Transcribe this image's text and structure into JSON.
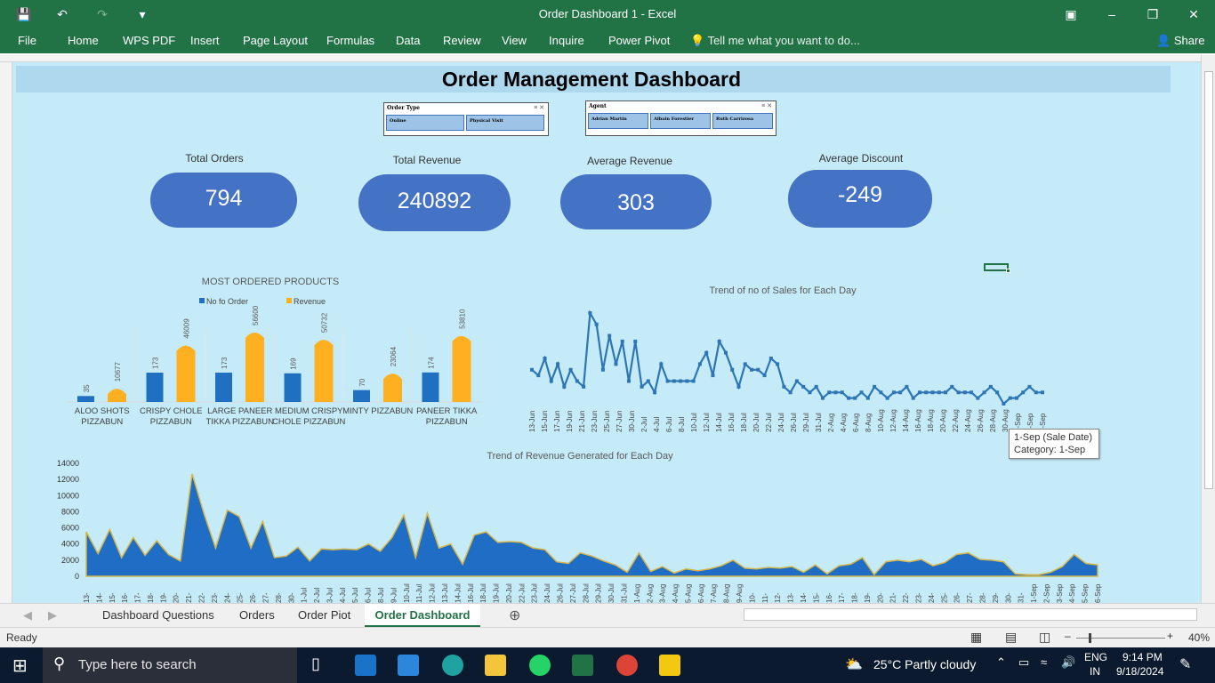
{
  "window": {
    "title": "Order Dashboard 1 - Excel"
  },
  "ribbon": {
    "tabs": [
      "File",
      "Home",
      "WPS PDF",
      "Insert",
      "Page Layout",
      "Formulas",
      "Data",
      "Review",
      "View",
      "Inquire",
      "Power Pivot"
    ],
    "tell_me": "Tell me what you want to do...",
    "share": "Share"
  },
  "dashboard": {
    "title": "Order Management Dashboard",
    "slicers": [
      {
        "header": "Order Type",
        "items": [
          "Online",
          "Physical Visit"
        ]
      },
      {
        "header": "Agent",
        "items": [
          "Adrian Martin",
          "Albain Forestier",
          "Ruth Carrizosa"
        ]
      }
    ],
    "kpis": [
      {
        "label": "Total Orders",
        "value": "794"
      },
      {
        "label": "Total Revenue",
        "value": "240892"
      },
      {
        "label": "Average Revenue",
        "value": "303"
      },
      {
        "label": "Average Discount",
        "value": "-249"
      }
    ]
  },
  "tooltip": {
    "line1": "1-Sep (Sale Date)",
    "line2": "Category: 1-Sep"
  },
  "sheet_tabs": [
    "Dashboard Questions",
    "Orders",
    "Order Piot",
    "Order Dashboard"
  ],
  "status": {
    "ready": "Ready",
    "zoom": "40%"
  },
  "taskbar": {
    "search_placeholder": "Type here to search",
    "weather": "25°C  Partly cloudy",
    "lang1": "ENG",
    "lang2": "IN",
    "time": "9:14 PM",
    "date": "9/18/2024",
    "notif_count": "1"
  },
  "colors": {
    "excel_green": "#217346",
    "kpi_blue": "#4472c4",
    "bar_blue": "#1f70c1",
    "bar_orange": "#ffb020",
    "sheet_bg": "#c5ebf8"
  },
  "chart_data": [
    {
      "type": "bar",
      "title": "MOST ORDERED PRODUCTS",
      "categories": [
        "ALOO SHOTS PIZZABUN",
        "CRISPY CHOLE PIZZABUN",
        "LARGE PANEER TIKKA PIZZABUN",
        "MEDIUM CRISPY CHOLE PIZZABUN",
        "MINTY PIZZABUN",
        "PANEER TIKKA PIZZABUN"
      ],
      "series": [
        {
          "name": "No fo Order",
          "values": [
            35,
            173,
            173,
            169,
            70,
            174
          ]
        },
        {
          "name": "Revenue",
          "values": [
            10677,
            46009,
            56600,
            50732,
            23064,
            53810
          ]
        }
      ],
      "legend": "top"
    },
    {
      "type": "line",
      "title": "Trend of no of Sales for Each Day",
      "x_labels": [
        "13-Jun",
        "15-Jun",
        "17-Jun",
        "19-Jun",
        "21-Jun",
        "23-Jun",
        "25-Jun",
        "27-Jun",
        "30-Jun",
        "2-Jul",
        "4-Jul",
        "6-Jul",
        "8-Jul",
        "10-Jul",
        "12-Jul",
        "14-Jul",
        "16-Jul",
        "18-Jul",
        "20-Jul",
        "22-Jul",
        "24-Jul",
        "26-Jul",
        "29-Jul",
        "31-Jul",
        "2-Aug",
        "4-Aug",
        "6-Aug",
        "8-Aug",
        "10-Aug",
        "12-Aug",
        "14-Aug",
        "16-Aug",
        "18-Aug",
        "20-Aug",
        "22-Aug",
        "24-Aug",
        "26-Aug",
        "28-Aug",
        "30-Aug",
        "1-Sep",
        "3-Sep",
        "5-Sep"
      ],
      "values": [
        6,
        5,
        8,
        4,
        7,
        3,
        6,
        4,
        3,
        16,
        14,
        6,
        12,
        7,
        11,
        4,
        11,
        3,
        4,
        2,
        7,
        4,
        4,
        4,
        4,
        4,
        7,
        9,
        5,
        11,
        9,
        6,
        3,
        7,
        6,
        6,
        5,
        8,
        7,
        3,
        2,
        4,
        3,
        2,
        3,
        1,
        2,
        2,
        2,
        1,
        1,
        2,
        1,
        3,
        2,
        1,
        2,
        2,
        3,
        1,
        2,
        2,
        2,
        2,
        2,
        3,
        2,
        2,
        2,
        1,
        2,
        3,
        2,
        0,
        1,
        1,
        2,
        3,
        2,
        2
      ],
      "grid": false
    },
    {
      "type": "area",
      "title": "Trend of Revenue Generated for Each Day",
      "y_ticks": [
        0,
        2000,
        4000,
        6000,
        8000,
        10000,
        12000,
        14000
      ],
      "ylim": [
        0,
        14000
      ],
      "x_labels": [
        "13-",
        "14-",
        "15-",
        "16-",
        "17-",
        "18-",
        "19-",
        "20-",
        "21-",
        "22-",
        "23-",
        "24-",
        "25-",
        "26-",
        "27-",
        "28-",
        "30-",
        "1-Jul",
        "2-Jul",
        "3-Jul",
        "4-Jul",
        "5-Jul",
        "6-Jul",
        "8-Jul",
        "9-Jul",
        "10-Jul",
        "11-Jul",
        "12-Jul",
        "13-Jul",
        "14-Jul",
        "16-Jul",
        "18-Jul",
        "19-Jul",
        "20-Jul",
        "22-Jul",
        "23-Jul",
        "24-Jul",
        "26-Jul",
        "27-Jul",
        "28-Jul",
        "29-Jul",
        "30-Jul",
        "31-Jul",
        "1-Aug",
        "2-Aug",
        "3-Aug",
        "4-Aug",
        "5-Aug",
        "6-Aug",
        "7-Aug",
        "8-Aug",
        "9-Aug",
        "10-",
        "11-",
        "12-",
        "13-",
        "14-",
        "15-",
        "16-",
        "17-",
        "18-",
        "19-",
        "20-",
        "21-",
        "22-",
        "23-",
        "24-",
        "25-",
        "26-",
        "27-",
        "28-",
        "29-",
        "30-",
        "31-",
        "1-Sep",
        "2-Sep",
        "3-Sep",
        "4-Sep",
        "5-Sep",
        "6-Sep"
      ],
      "values": [
        5500,
        2800,
        5800,
        2300,
        4800,
        2600,
        4400,
        2700,
        1900,
        12700,
        7800,
        3500,
        8200,
        7400,
        3500,
        6800,
        2300,
        2500,
        3600,
        1900,
        3400,
        3300,
        3400,
        3300,
        4000,
        3100,
        4800,
        7600,
        2300,
        7800,
        3500,
        4000,
        1500,
        5100,
        5500,
        4200,
        4300,
        4200,
        3500,
        3300,
        1800,
        1600,
        2900,
        2500,
        1900,
        1400,
        500,
        2900,
        600,
        1200,
        400,
        900,
        700,
        900,
        1300,
        2000,
        1000,
        900,
        1100,
        1000,
        1200,
        500,
        1400,
        300,
        1300,
        1500,
        2300,
        200,
        1800,
        2000,
        1800,
        2100,
        1300,
        1700,
        2700,
        2900,
        2100,
        2000,
        1800,
        300,
        200,
        200,
        500,
        1200,
        2700,
        1600,
        1400
      ]
    }
  ]
}
